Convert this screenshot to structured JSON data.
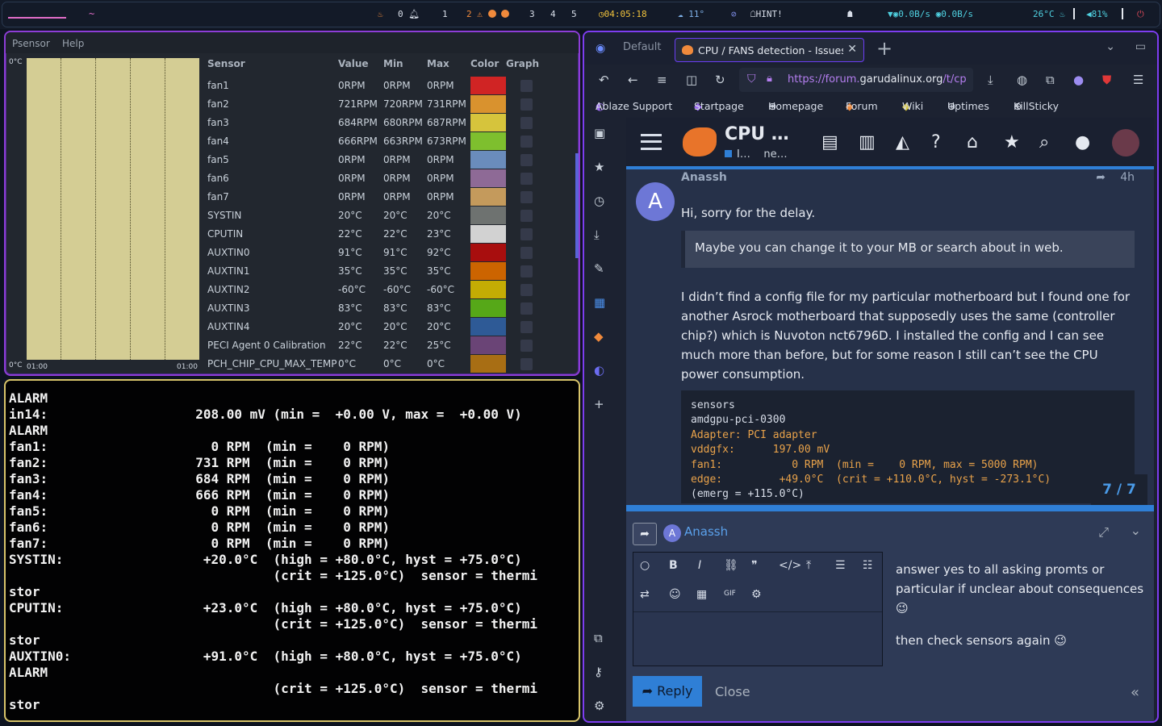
{
  "topbar": {
    "workspace_prompt": "~",
    "notifications_count": "0",
    "workspaces": [
      "1",
      "2",
      "3",
      "4",
      "5"
    ],
    "time": "04:05:18",
    "weather": "11°",
    "hint": "HINT!",
    "net_up": "0.0B/s",
    "net_down": "0.0B/s",
    "cpu_temp": "26°C",
    "volume": "81%"
  },
  "psensor": {
    "menu": [
      "Psensor",
      "Help"
    ],
    "graph": {
      "y_top": "0°C",
      "y_bottom": "0°C",
      "x_left": "01:00",
      "x_right": "01:00"
    },
    "headers": {
      "sensor": "Sensor",
      "value": "Value",
      "min": "Min",
      "max": "Max",
      "color": "Color",
      "graph": "Graph"
    },
    "rows": [
      {
        "sensor": "fan1",
        "value": "0RPM",
        "min": "0RPM",
        "max": "0RPM",
        "color": "#d02424"
      },
      {
        "sensor": "fan2",
        "value": "721RPM",
        "min": "720RPM",
        "max": "731RPM",
        "color": "#d9922e"
      },
      {
        "sensor": "fan3",
        "value": "684RPM",
        "min": "680RPM",
        "max": "687RPM",
        "color": "#d6c43c"
      },
      {
        "sensor": "fan4",
        "value": "666RPM",
        "min": "663RPM",
        "max": "673RPM",
        "color": "#7ebf2e"
      },
      {
        "sensor": "fan5",
        "value": "0RPM",
        "min": "0RPM",
        "max": "0RPM",
        "color": "#6a8cbc"
      },
      {
        "sensor": "fan6",
        "value": "0RPM",
        "min": "0RPM",
        "max": "0RPM",
        "color": "#8e6a96"
      },
      {
        "sensor": "fan7",
        "value": "0RPM",
        "min": "0RPM",
        "max": "0RPM",
        "color": "#c49a5c"
      },
      {
        "sensor": "SYSTIN",
        "value": "20°C",
        "min": "20°C",
        "max": "20°C",
        "color": "#6e7270"
      },
      {
        "sensor": "CPUTIN",
        "value": "22°C",
        "min": "22°C",
        "max": "23°C",
        "color": "#d2d2d2"
      },
      {
        "sensor": "AUXTIN0",
        "value": "91°C",
        "min": "91°C",
        "max": "92°C",
        "color": "#a80e0e"
      },
      {
        "sensor": "AUXTIN1",
        "value": "35°C",
        "min": "35°C",
        "max": "35°C",
        "color": "#cc6400"
      },
      {
        "sensor": "AUXTIN2",
        "value": "-60°C",
        "min": "-60°C",
        "max": "-60°C",
        "color": "#c4ac04"
      },
      {
        "sensor": "AUXTIN3",
        "value": "83°C",
        "min": "83°C",
        "max": "83°C",
        "color": "#56a818"
      },
      {
        "sensor": "AUXTIN4",
        "value": "20°C",
        "min": "20°C",
        "max": "20°C",
        "color": "#2e5a96"
      },
      {
        "sensor": "PECI Agent 0 Calibration",
        "value": "22°C",
        "min": "22°C",
        "max": "25°C",
        "color": "#6a4476"
      },
      {
        "sensor": "PCH_CHIP_CPU_MAX_TEMP",
        "value": "0°C",
        "min": "0°C",
        "max": "0°C",
        "color": "#a86e14"
      }
    ]
  },
  "terminal": {
    "lines": [
      "ALARM",
      "in14:                   208.00 mV (min =  +0.00 V, max =  +0.00 V)",
      "ALARM",
      "fan1:                     0 RPM  (min =    0 RPM)",
      "fan2:                   731 RPM  (min =    0 RPM)",
      "fan3:                   684 RPM  (min =    0 RPM)",
      "fan4:                   666 RPM  (min =    0 RPM)",
      "fan5:                     0 RPM  (min =    0 RPM)",
      "fan6:                     0 RPM  (min =    0 RPM)",
      "fan7:                     0 RPM  (min =    0 RPM)",
      "SYSTIN:                  +20.0°C  (high = +80.0°C, hyst = +75.0°C)",
      "                                  (crit = +125.0°C)  sensor = thermi",
      "stor",
      "CPUTIN:                  +23.0°C  (high = +80.0°C, hyst = +75.0°C)",
      "                                  (crit = +125.0°C)  sensor = thermi",
      "stor",
      "AUXTIN0:                 +91.0°C  (high = +80.0°C, hyst = +75.0°C)",
      "ALARM",
      "                                  (crit = +125.0°C)  sensor = thermi",
      "stor"
    ]
  },
  "browser": {
    "tab_default": "Default",
    "tab_active": "CPU / FANS detection - Issues",
    "url_prefix": "https://forum.",
    "url_domain": "garudalinux.org",
    "url_rest": "/t/cp",
    "bookmarks": [
      "Ablaze Support",
      "Startpage",
      "Homepage",
      "Forum",
      "Wiki",
      "Uptimes",
      "KillSticky"
    ]
  },
  "forum": {
    "title": "CPU …",
    "subtitle_left": "I…",
    "subtitle_right": "ne…",
    "post": {
      "author": "Anassh",
      "avatar_letter": "A",
      "time": "4h",
      "greeting": "Hi, sorry for the delay.",
      "quote": "Maybe you can change it to your MB or search about in web.",
      "body": "I didn’t find a config file for my particular motherboard but I found one for another Asrock motherboard that supposedly uses the same (controller chip?) which is Nuvoton nct6796D. I installed the config and I can see much more than before, but for some reason I still can’t see the CPU power consumption.",
      "code": [
        "sensors",
        "amdgpu-pci-0300",
        "Adapter: PCI adapter",
        "vddgfx:      197.00 mV",
        "fan1:           0 RPM  (min =    0 RPM, max = 5000 RPM)",
        "edge:         +49.0°C  (crit = +110.0°C, hyst = -273.1°C)",
        "(emerg = +115.0°C)"
      ]
    },
    "progress": "7 / 7",
    "composer": {
      "reply_to": "Anassh",
      "preview_p1": "answer yes to all asking promts or particular if unclear about consequences 😉",
      "preview_p2": "then check sensors again 😉",
      "reply_label": "Reply",
      "close_label": "Close"
    }
  }
}
